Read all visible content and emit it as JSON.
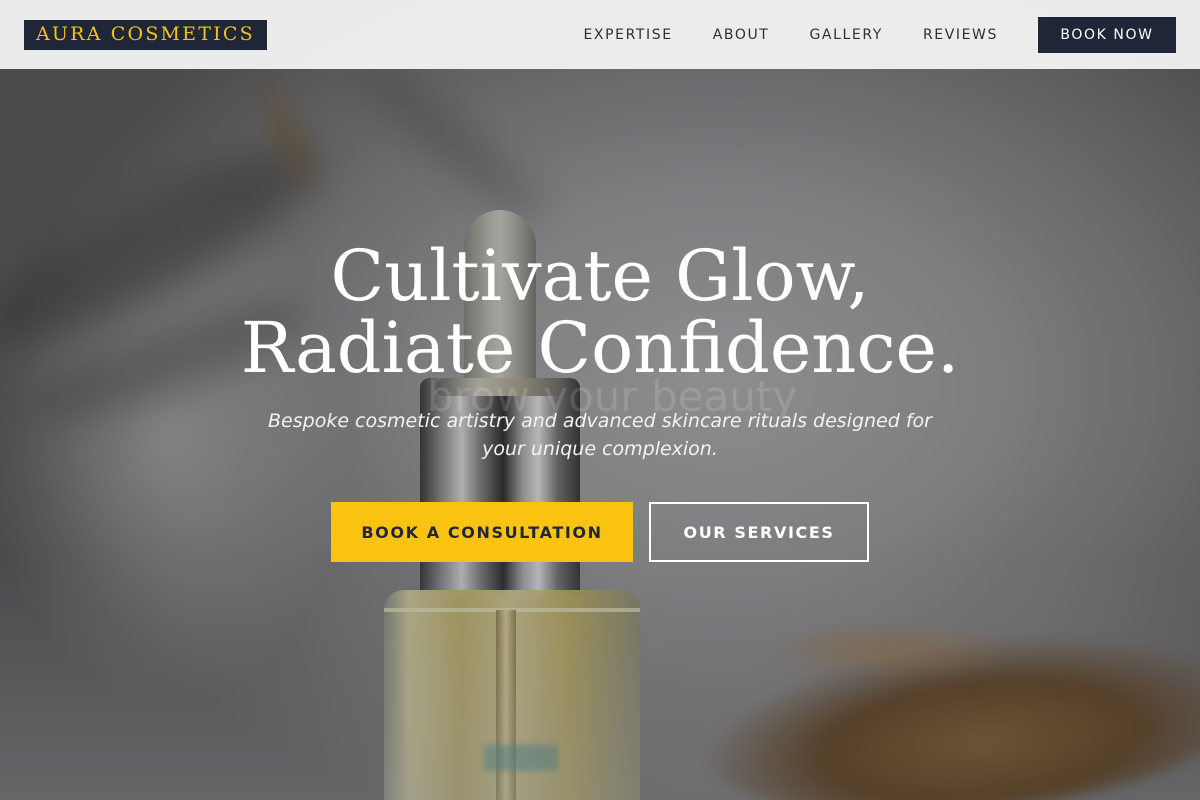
{
  "brand": {
    "logo_text": "AURA COSMETICS",
    "colors": {
      "navy": "#1e2638",
      "gold": "#f3c319",
      "cta_yellow": "#fbc311",
      "header_bg": "#f1f1f1"
    }
  },
  "nav": {
    "links": [
      {
        "label": "EXPERTISE"
      },
      {
        "label": "ABOUT"
      },
      {
        "label": "GALLERY"
      },
      {
        "label": "REVIEWS"
      }
    ],
    "book_now_label": "BOOK NOW"
  },
  "hero": {
    "title_line1": "Cultivate Glow,",
    "title_line2": "Radiate Confidence.",
    "subtitle_line1": "Bespoke cosmetic artistry and advanced skincare rituals designed for",
    "subtitle_line2": "your unique complexion.",
    "background_text": "brow your beauty",
    "cta_primary_label": "BOOK A CONSULTATION",
    "cta_secondary_label": "OUR SERVICES",
    "background_image": "serum-dropper-bottle-photo"
  }
}
